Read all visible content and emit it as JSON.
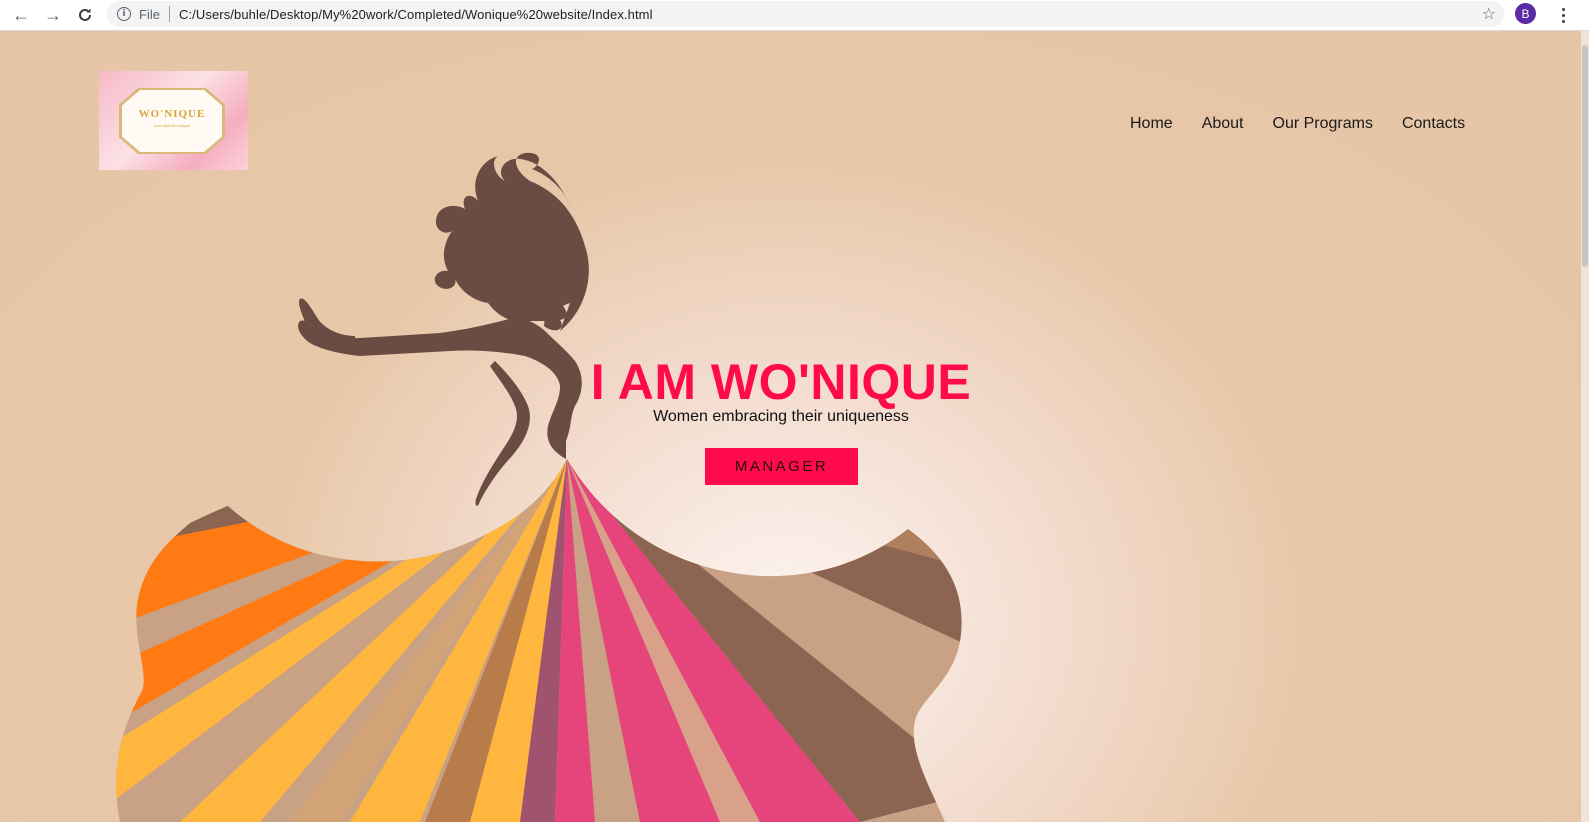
{
  "browser": {
    "scheme_label": "File",
    "url": "C:/Users/buhle/Desktop/My%20work/Completed/Wonique%20website/Index.html",
    "profile_initial": "B",
    "icons": [
      "back-arrow-icon",
      "forward-arrow-icon",
      "reload-icon",
      "info-icon",
      "star-icon",
      "more-menu-icon"
    ]
  },
  "logo": {
    "name": "WO'NIQUE",
    "tagline": "love and feel unique"
  },
  "nav": {
    "items": [
      {
        "label": "Home"
      },
      {
        "label": "About"
      },
      {
        "label": "Our Programs"
      },
      {
        "label": "Contacts"
      }
    ]
  },
  "hero": {
    "title": "I AM WO'NIQUE",
    "subtitle": "Women embracing their uniqueness",
    "button_label": "MANAGER"
  },
  "colors": {
    "accent": "#ff0a4b",
    "background": "#e8c8a9",
    "silhouette": "#6b4c42",
    "dress_orange": "#ff7a12",
    "dress_yellow": "#ffb63e",
    "dress_pink": "#e6457c",
    "dress_brown": "#8b6452",
    "dress_tan": "#c9a285"
  }
}
